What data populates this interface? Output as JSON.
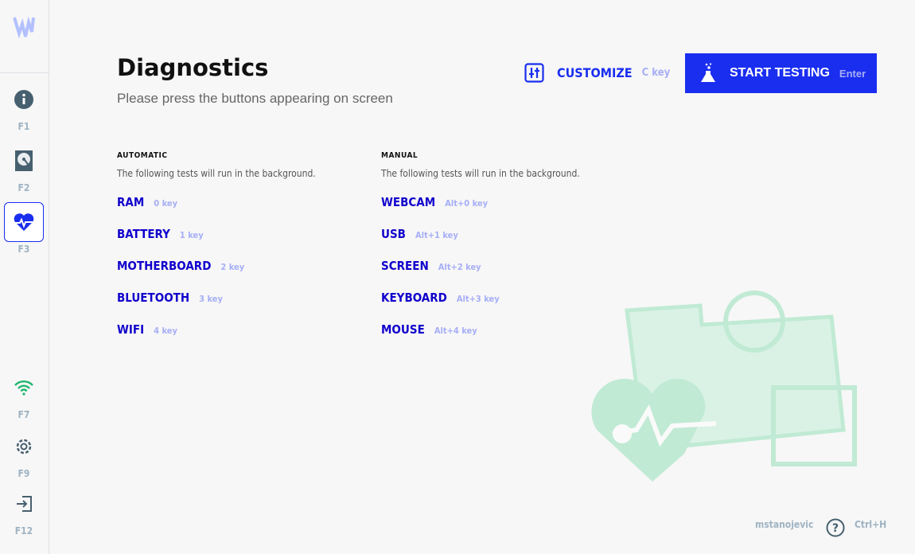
{
  "sidebar": {
    "items": [
      {
        "icon": "info-icon",
        "key": "F1"
      },
      {
        "icon": "hard-disk-icon",
        "key": "F2"
      },
      {
        "icon": "heart-pulse-icon",
        "key": "F3",
        "active": true
      },
      {
        "icon": "wifi-icon",
        "key": "F7"
      },
      {
        "icon": "gear-icon",
        "key": "F9"
      },
      {
        "icon": "logout-icon",
        "key": "F12"
      }
    ]
  },
  "header": {
    "title": "Diagnostics",
    "subtitle": "Please press the buttons appearing on screen"
  },
  "toolbar": {
    "customize_label": "CUSTOMIZE",
    "customize_key": "C key",
    "start_label": "START TESTING",
    "start_key": "Enter"
  },
  "automatic": {
    "heading": "AUTOMATIC",
    "description": "The following tests will run in the background.",
    "tests": [
      {
        "name": "RAM",
        "key": "0 key"
      },
      {
        "name": "BATTERY",
        "key": "1 key"
      },
      {
        "name": "MOTHERBOARD",
        "key": "2 key"
      },
      {
        "name": "BLUETOOTH",
        "key": "3 key"
      },
      {
        "name": "WIFI",
        "key": "4 key"
      }
    ]
  },
  "manual": {
    "heading": "MANUAL",
    "description": "The following tests will run in the background.",
    "tests": [
      {
        "name": "WEBCAM",
        "key": "Alt+0 key"
      },
      {
        "name": "USB",
        "key": "Alt+1 key"
      },
      {
        "name": "SCREEN",
        "key": "Alt+2 key"
      },
      {
        "name": "KEYBOARD",
        "key": "Alt+3 key"
      },
      {
        "name": "MOUSE",
        "key": "Alt+4 key"
      }
    ]
  },
  "footer": {
    "username": "mstanojevic",
    "help_key": "Ctrl+H"
  },
  "colors": {
    "accent": "#1a2ef0",
    "test_name": "#1100cc",
    "key_hint": "#a6aef6",
    "illustration": "#7fdcaa"
  }
}
